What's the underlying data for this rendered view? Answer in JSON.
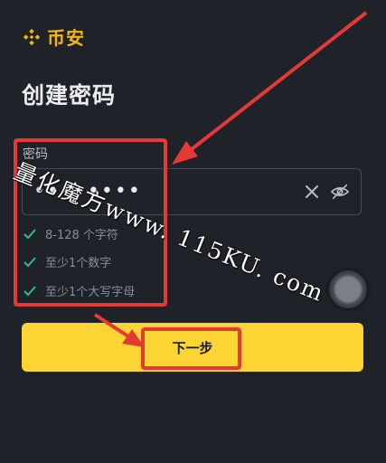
{
  "brand": {
    "logo_text": "币安",
    "accent": "#f0b90b"
  },
  "page": {
    "title": "创建密码"
  },
  "password_field": {
    "label": "密码",
    "value": "••••••••",
    "clear_icon": "close-icon",
    "visibility_icon": "eye-off-icon"
  },
  "requirements": [
    {
      "text": "8-128 个字符",
      "status": "met"
    },
    {
      "text": "至少1个数字",
      "status": "met"
    },
    {
      "text": "至少1个大写字母",
      "status": "met"
    }
  ],
  "actions": {
    "next_label": "下一步",
    "next_color": "#fcd535"
  },
  "watermark": {
    "text": "量化魔方www. 115KU. com"
  },
  "annotation": {
    "color": "#e53935"
  }
}
